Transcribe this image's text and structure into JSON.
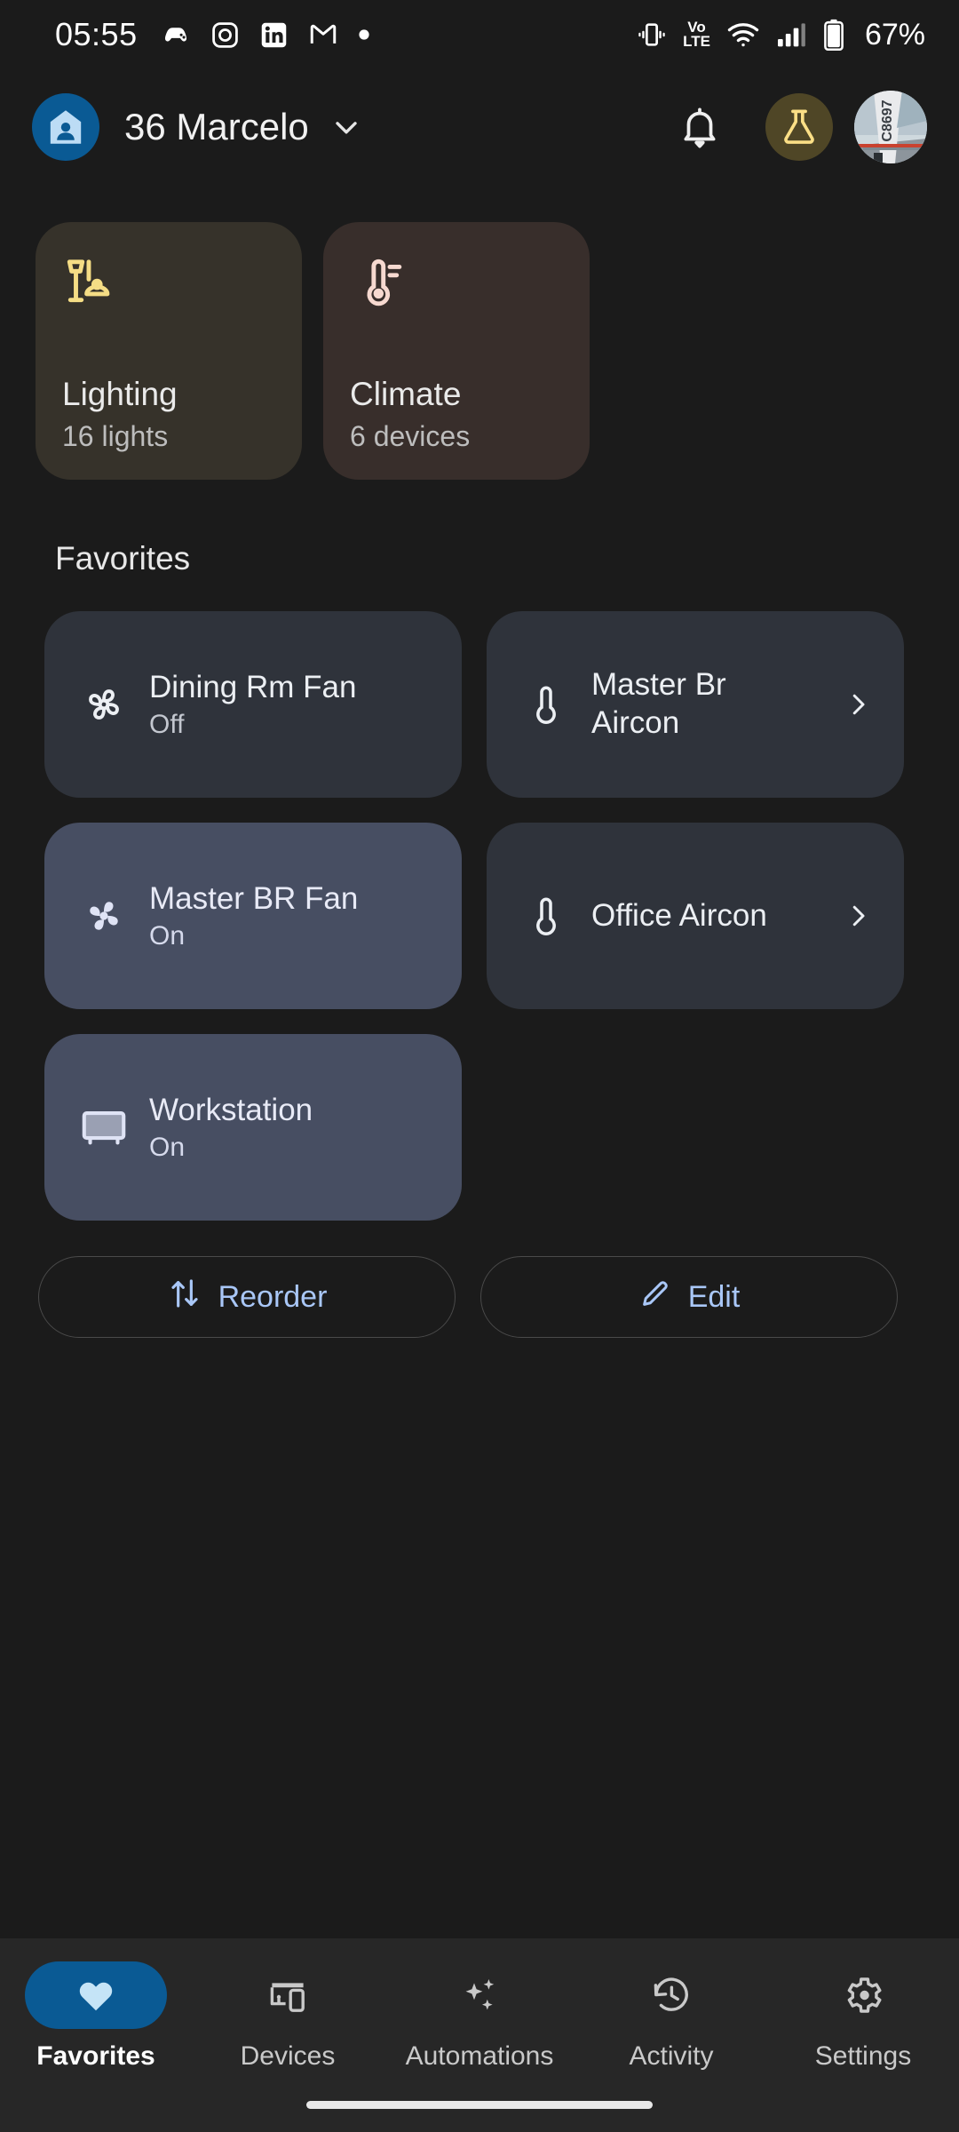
{
  "status_bar": {
    "time": "05:55",
    "left_icons": [
      "game-controller-icon",
      "instagram-icon",
      "linkedin-icon",
      "gmail-icon",
      "dot-icon"
    ],
    "right_icons": [
      "vibrate-icon",
      "volte-icon",
      "wifi-icon",
      "cellular-signal-icon",
      "battery-icon"
    ],
    "battery_percent": "67%",
    "volte_top": "Vo",
    "volte_bottom": "LTE"
  },
  "header": {
    "home_icon": "home-person-icon",
    "home_name": "36 Marcelo",
    "chevron": "chevron-down-icon",
    "notifications_icon": "bell-icon",
    "labs_icon": "flask-icon",
    "account_avatar": "user-avatar-photo"
  },
  "areas": [
    {
      "icon": "floor-lamp-icon",
      "title": "Lighting",
      "subtitle": "16 lights",
      "bg": "#36322a",
      "icon_color": "#f5dd85"
    },
    {
      "icon": "thermometer-icon",
      "title": "Climate",
      "subtitle": "6 devices",
      "bg": "#382e2b",
      "icon_color": "#f7d9d0"
    }
  ],
  "favorites": {
    "section_label": "Favorites",
    "items": [
      {
        "icon": "fan-icon",
        "name": "Dining Rm Fan",
        "state": "Off",
        "active": false,
        "chevron": false
      },
      {
        "icon": "thermostat-icon",
        "name": "Master Br Aircon",
        "state": "",
        "active": false,
        "chevron": true
      },
      {
        "icon": "fan-icon",
        "name": "Master BR Fan",
        "state": "On",
        "active": true,
        "chevron": false
      },
      {
        "icon": "thermostat-icon",
        "name": "Office Aircon",
        "state": "",
        "active": false,
        "chevron": true
      },
      {
        "icon": "tv-icon",
        "name": "Workstation",
        "state": "On",
        "active": true,
        "chevron": false
      }
    ],
    "actions": [
      {
        "icon": "swap-vertical-icon",
        "label": "Reorder"
      },
      {
        "icon": "pencil-icon",
        "label": "Edit"
      }
    ]
  },
  "bottom_nav": {
    "items": [
      {
        "icon": "heart-icon",
        "label": "Favorites",
        "active": true
      },
      {
        "icon": "devices-icon",
        "label": "Devices",
        "active": false
      },
      {
        "icon": "sparkles-icon",
        "label": "Automations",
        "active": false
      },
      {
        "icon": "history-icon",
        "label": "Activity",
        "active": false
      },
      {
        "icon": "gear-icon",
        "label": "Settings",
        "active": false
      }
    ]
  },
  "colors": {
    "page_bg": "#1b1b1b",
    "nav_bg": "#272727",
    "accent_blue": "#0a5a94",
    "card_active": "#474e62",
    "card_inactive": "#2f333b",
    "link_blue": "#a9c7f7"
  }
}
